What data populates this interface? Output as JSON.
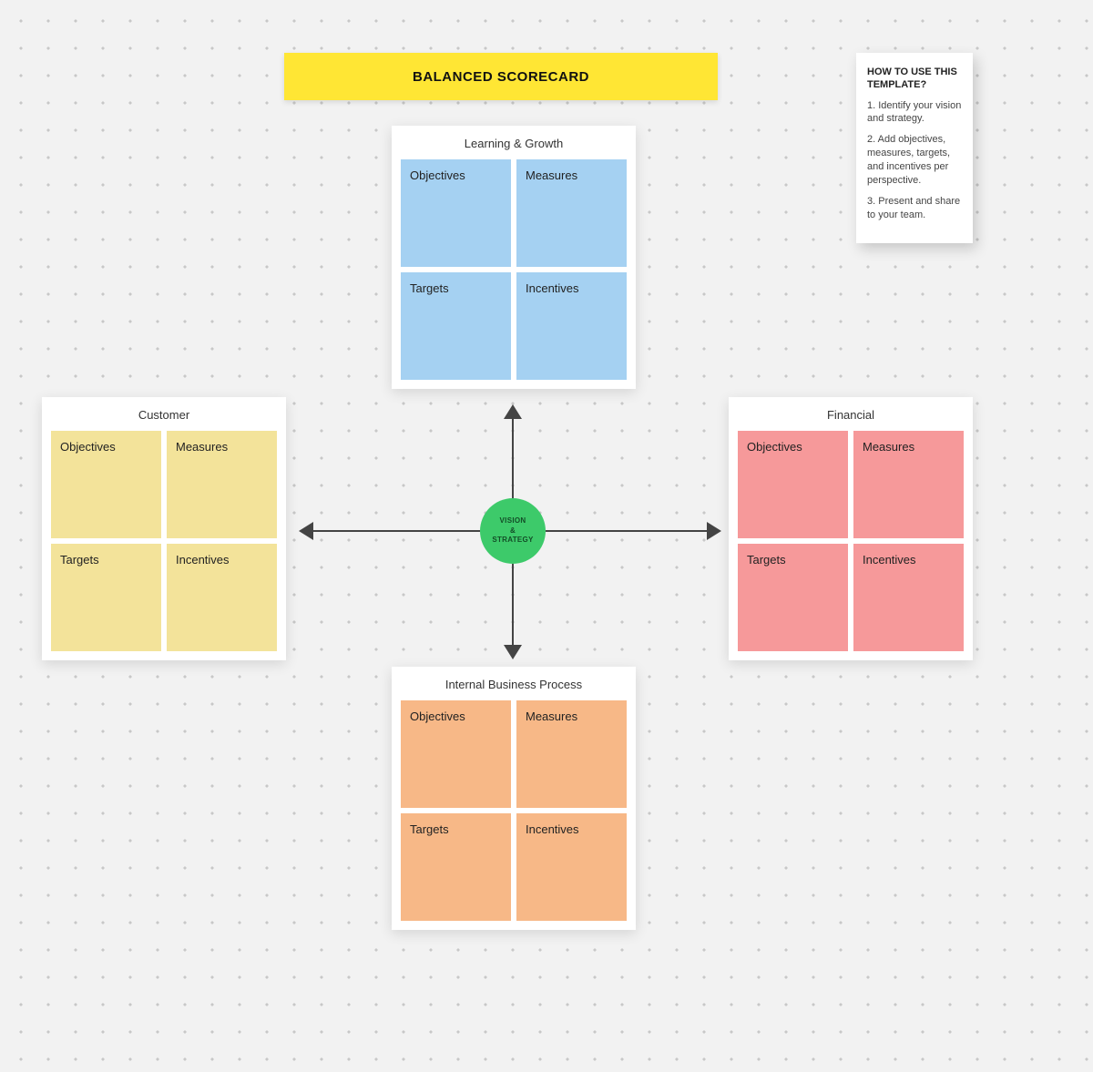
{
  "title": "BALANCED SCORECARD",
  "help": {
    "title": "HOW TO USE THIS TEMPLATE?",
    "steps": [
      "1. Identify your vision and strategy.",
      "2. Add objectives, measures, targets, and incentives per perspective.",
      "3. Present and share to your team."
    ]
  },
  "center": {
    "line1": "VISION",
    "line2": "&",
    "line3": "STRATEGY"
  },
  "cells": {
    "objectives": "Objectives",
    "measures": "Measures",
    "targets": "Targets",
    "incentives": "Incentives"
  },
  "perspectives": {
    "top": {
      "title": "Learning & Growth"
    },
    "left": {
      "title": "Customer"
    },
    "right": {
      "title": "Financial"
    },
    "bottom": {
      "title": "Internal Business Process"
    }
  },
  "colors": {
    "banner": "#ffe634",
    "center": "#3dca6a",
    "top": "#a5d1f2",
    "left": "#f3e39a",
    "bottom": "#f7b887",
    "right": "#f6999a"
  }
}
